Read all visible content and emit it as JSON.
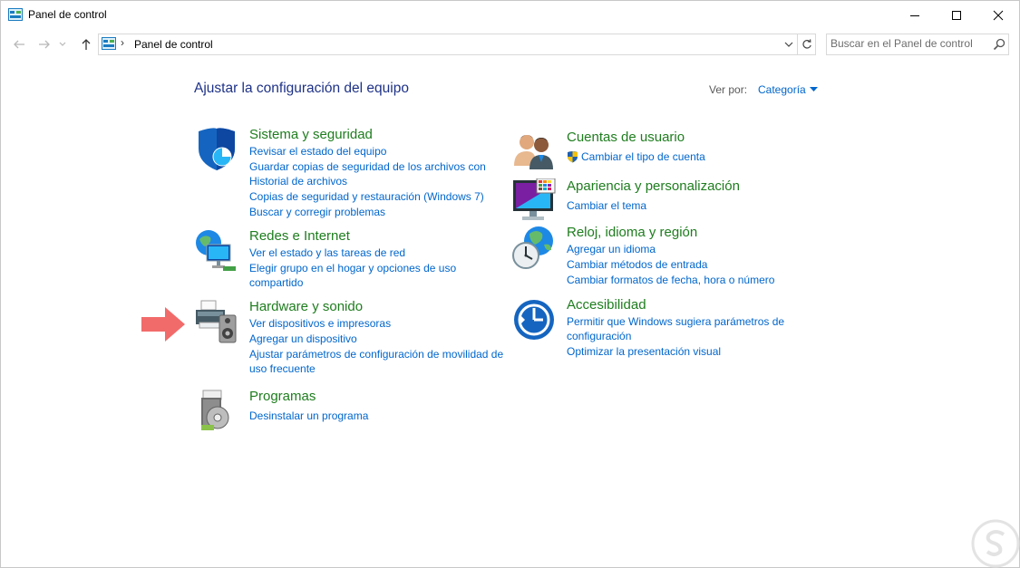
{
  "window": {
    "title": "Panel de control",
    "icon": "control-panel-icon"
  },
  "nav": {
    "back_icon": "arrow-left-icon",
    "forward_icon": "arrow-right-icon",
    "recent_icon": "chevron-down-icon",
    "up_icon": "arrow-up-icon"
  },
  "address": {
    "separator": "›",
    "path": "Panel de control"
  },
  "search": {
    "placeholder": "Buscar en el Panel de control"
  },
  "header": {
    "title": "Ajustar la configuración del equipo",
    "view_by_label": "Ver por:",
    "view_by_value": "Categoría"
  },
  "categories_left": [
    {
      "title": "Sistema y seguridad",
      "icon": "shield-icon",
      "links": [
        "Revisar el estado del equipo",
        "Guardar copias de seguridad de los archivos con Historial de archivos",
        "Copias de seguridad y restauración (Windows 7)",
        "Buscar y corregir problemas"
      ]
    },
    {
      "title": "Redes e Internet",
      "icon": "network-globe-icon",
      "links": [
        "Ver el estado y las tareas de red",
        "Elegir grupo en el hogar y opciones de uso compartido"
      ]
    },
    {
      "title": "Hardware y sonido",
      "icon": "printer-speaker-icon",
      "links": [
        "Ver dispositivos e impresoras",
        "Agregar un dispositivo",
        "Ajustar parámetros de configuración de movilidad de uso frecuente"
      ]
    },
    {
      "title": "Programas",
      "icon": "programs-disc-icon",
      "links": [
        "Desinstalar un programa"
      ]
    }
  ],
  "categories_right": [
    {
      "title": "Cuentas de usuario",
      "icon": "users-icon",
      "links": [
        "Cambiar el tipo de cuenta"
      ]
    },
    {
      "title": "Apariencia y personalización",
      "icon": "monitor-palette-icon",
      "links": [
        "Cambiar el tema"
      ]
    },
    {
      "title": "Reloj, idioma y región",
      "icon": "clock-globe-icon",
      "links": [
        "Agregar un idioma",
        "Cambiar métodos de entrada",
        "Cambiar formatos de fecha, hora o número"
      ]
    },
    {
      "title": "Accesibilidad",
      "icon": "accessibility-icon",
      "links": [
        "Permitir que Windows sugiera parámetros de configuración",
        "Optimizar la presentación visual"
      ]
    }
  ],
  "colors": {
    "title_blue": "#1e3287",
    "category_green": "#1e7d1e",
    "link_blue": "#0066cc",
    "arrow_red": "#f26b6b"
  }
}
